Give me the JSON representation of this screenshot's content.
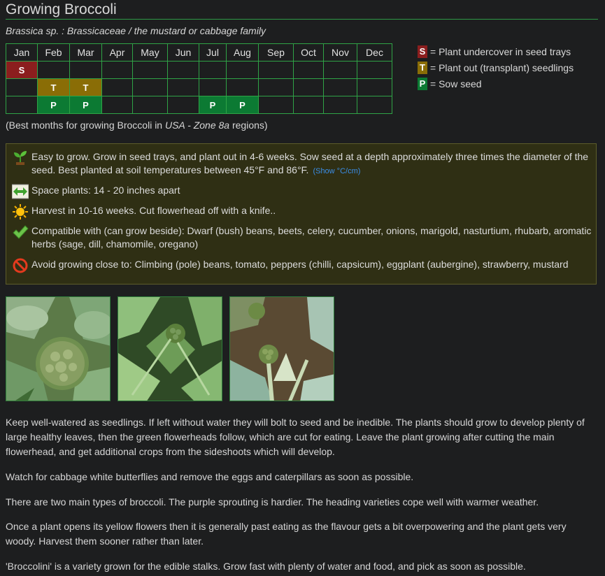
{
  "page": {
    "title": "Growing Broccoli",
    "subtitle": "Brassica sp. : Brassicaceae / the mustard or cabbage family"
  },
  "calendar": {
    "months": [
      "Jan",
      "Feb",
      "Mar",
      "Apr",
      "May",
      "Jun",
      "Jul",
      "Aug",
      "Sep",
      "Oct",
      "Nov",
      "Dec"
    ],
    "rows": [
      [
        "S",
        "",
        "",
        "",
        "",
        "",
        "",
        "",
        "",
        "",
        "",
        ""
      ],
      [
        "",
        "T",
        "T",
        "",
        "",
        "",
        "",
        "",
        "",
        "",
        "",
        ""
      ],
      [
        "",
        "P",
        "P",
        "",
        "",
        "",
        "P",
        "P",
        "",
        "",
        "",
        ""
      ]
    ]
  },
  "legend": [
    {
      "key": "S",
      "text": "= Plant undercover in seed trays",
      "color": "#8b1e1e"
    },
    {
      "key": "T",
      "text": "= Plant out (transplant) seedlings",
      "color": "#8a6d06"
    },
    {
      "key": "P",
      "text": "= Sow seed",
      "color": "#0c7a33"
    }
  ],
  "note": {
    "prefix": "(Best months for growing Broccoli in ",
    "region": "USA - Zone 8a",
    "suffix": " regions)"
  },
  "info": {
    "grow": {
      "icon": "seedling-icon",
      "text": "Easy to grow. Grow in seed trays, and plant out in 4-6 weeks. Sow seed at a depth approximately three times the diameter of the seed. Best planted at soil temperatures between 45°F and 86°F.",
      "link": "(Show °C/cm)"
    },
    "spacing": {
      "icon": "spacing-arrows-icon",
      "text": "Space plants: 14 - 20 inches apart"
    },
    "harvest": {
      "icon": "sun-icon",
      "text": "Harvest in 10-16 weeks. Cut flowerhead off with a knife.."
    },
    "compatible": {
      "icon": "checkmark-icon",
      "text": "Compatible with (can grow beside): Dwarf (bush) beans, beets, celery, cucumber, onions, marigold, nasturtium, rhubarb, aromatic herbs (sage, dill, chamomile, oregano)"
    },
    "avoid": {
      "icon": "prohibited-icon",
      "text": "Avoid growing close to: Climbing (pole) beans, tomato, peppers (chilli, capsicum), eggplant (aubergine), strawberry, mustard"
    }
  },
  "photos": [
    "broccoli-head-photo",
    "broccoli-young-head-photo",
    "broccoli-sideshoots-photo"
  ],
  "paragraphs": [
    "Keep well-watered as seedlings. If left without water they will bolt to seed and be inedible. The plants should grow to develop plenty of large healthy leaves, then the green flowerheads follow, which are cut for eating. Leave the plant growing after cutting the main flowerhead, and get additional crops from the sideshoots which will develop.",
    "Watch for cabbage white butterflies and remove the eggs and caterpillars as soon as possible.",
    "There are two main types of broccoli. The purple sprouting is hardier. The heading varieties cope well with warmer weather.",
    "Once a plant opens its yellow flowers then it is generally past eating as the flavour gets a bit overpowering and the plant gets very woody. Harvest them sooner rather than later.",
    "'Broccolini' is a variety grown for the edible stalks. Grow fast with plenty of water and food, and pick as soon as possible."
  ]
}
